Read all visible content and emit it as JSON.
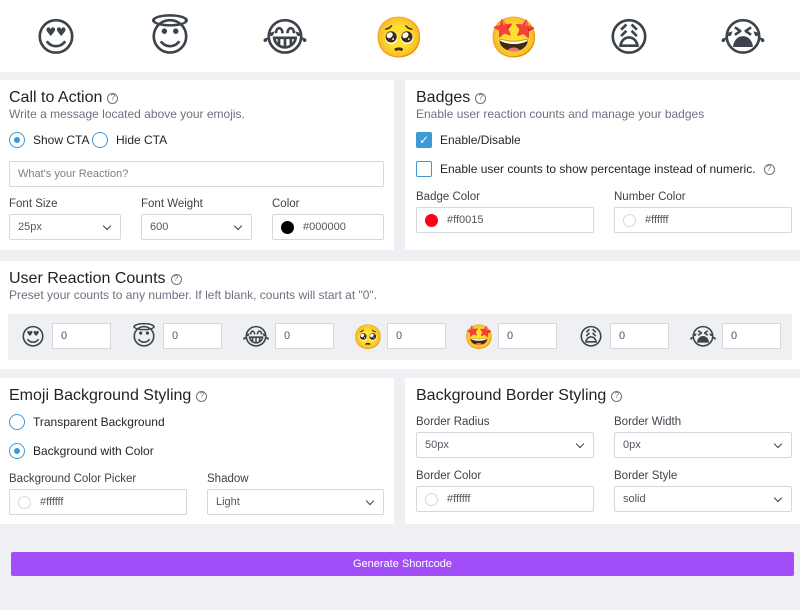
{
  "emojis": [
    {
      "name": "heart-eyes",
      "glyph": "😍"
    },
    {
      "name": "halo",
      "glyph": "😇"
    },
    {
      "name": "tears-of-joy",
      "glyph": "😂"
    },
    {
      "name": "pleading",
      "glyph": "🥺"
    },
    {
      "name": "star-struck",
      "glyph": "🤩"
    },
    {
      "name": "weary",
      "glyph": "😩"
    },
    {
      "name": "crying",
      "glyph": "😭"
    }
  ],
  "cta": {
    "title": "Call to Action",
    "subtitle": "Write a message located above your emojis.",
    "show_label": "Show CTA",
    "hide_label": "Hide CTA",
    "show_selected": true,
    "message_placeholder": "What's your Reaction?",
    "font_size_label": "Font Size",
    "font_size_value": "25px",
    "font_weight_label": "Font Weight",
    "font_weight_value": "600",
    "color_label": "Color",
    "color_value": "#000000"
  },
  "badges": {
    "title": "Badges",
    "subtitle": "Enable user reaction counts and manage your badges",
    "enable_label": "Enable/Disable",
    "enable_checked": true,
    "percentage_label": "Enable user counts to show percentage instead of numeric.",
    "percentage_checked": false,
    "badge_color_label": "Badge Color",
    "badge_color_value": "#ff0015",
    "number_color_label": "Number Color",
    "number_color_value": "#ffffff"
  },
  "counts": {
    "title": "User Reaction Counts",
    "subtitle": "Preset your counts to any number. If left blank, counts will start at \"0\".",
    "values": [
      "0",
      "0",
      "0",
      "0",
      "0",
      "0",
      "0"
    ]
  },
  "emoji_bg": {
    "title": "Emoji Background Styling",
    "transparent_label": "Transparent Background",
    "color_label": "Background with Color",
    "with_color_selected": true,
    "picker_label": "Background Color Picker",
    "picker_value": "#ffffff",
    "shadow_label": "Shadow",
    "shadow_value": "Light"
  },
  "border": {
    "title": "Background Border Styling",
    "radius_label": "Border Radius",
    "radius_value": "50px",
    "width_label": "Border Width",
    "width_value": "0px",
    "color_label": "Border Color",
    "color_value": "#ffffff",
    "style_label": "Border Style",
    "style_value": "solid"
  },
  "generate_label": "Generate Shortcode",
  "colors": {
    "accent": "#3d9ad6",
    "button": "#a24ef8",
    "badge": "#ff0015"
  }
}
